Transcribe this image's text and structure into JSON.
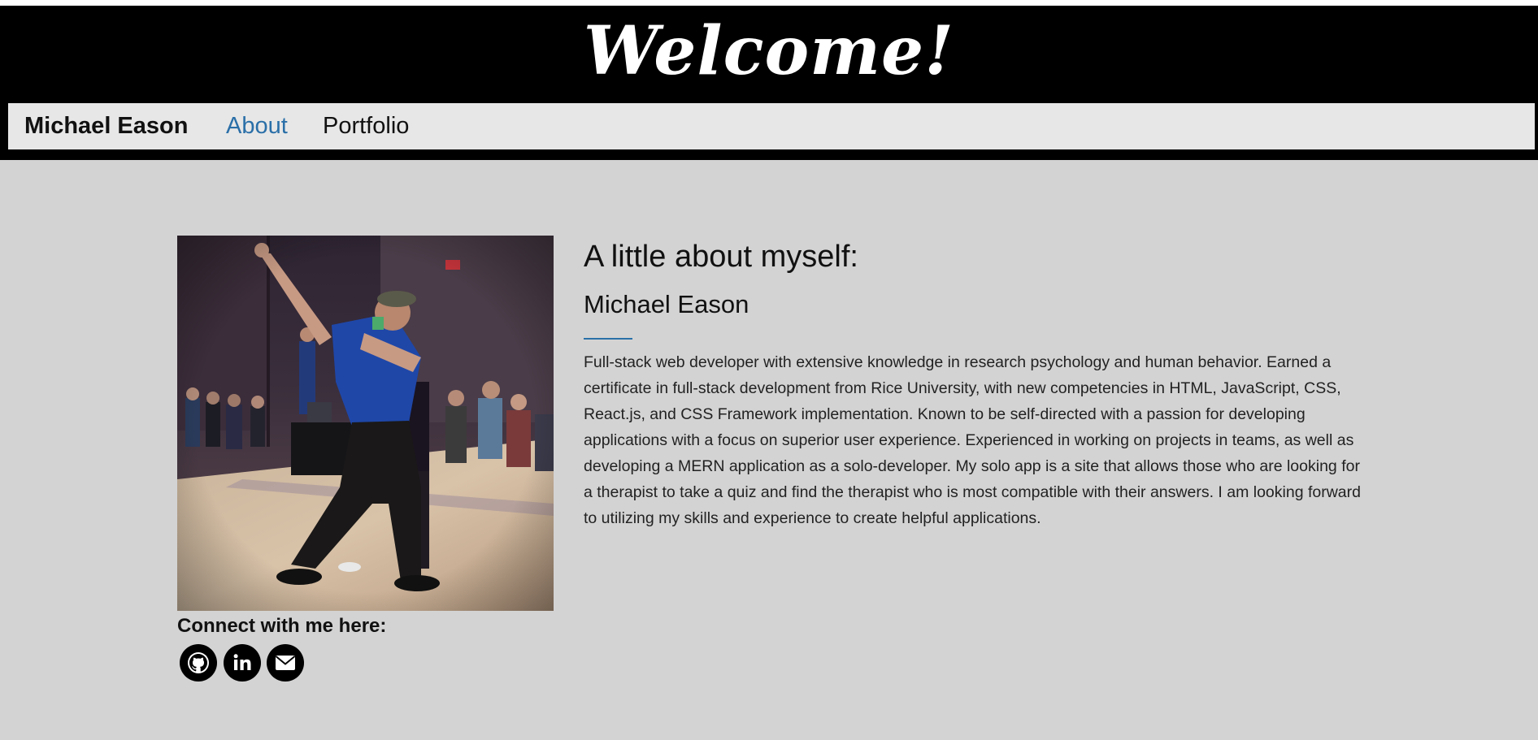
{
  "header": {
    "title": "Welcome!"
  },
  "navbar": {
    "brand": "Michael Eason",
    "links": [
      {
        "label": "About",
        "active": true
      },
      {
        "label": "Portfolio",
        "active": false
      }
    ]
  },
  "about": {
    "heading": "A little about myself:",
    "name": "Michael Eason",
    "bio": "Full-stack web developer with extensive knowledge in research psychology and human behavior. Earned a certificate in full-stack development from Rice University, with new competencies in HTML, JavaScript, CSS, React.js, and CSS Framework implementation. Known to be self-directed with a passion for developing applications with a focus on superior user experience. Experienced in working on projects in teams, as well as developing a MERN application as a solo-developer. My solo app is a site that allows those who are looking for a therapist to take a quiz and find the therapist who is most compatible with their answers. I am looking forward to utilizing my skills and experience to create helpful applications."
  },
  "connect": {
    "title": "Connect with me here:",
    "icons": [
      "github-icon",
      "linkedin-icon",
      "envelope-icon"
    ]
  },
  "colors": {
    "header_bg": "#000000",
    "navbar_bg": "#e7e7e7",
    "page_bg": "#d3d3d3",
    "accent": "#2a6fa8"
  }
}
